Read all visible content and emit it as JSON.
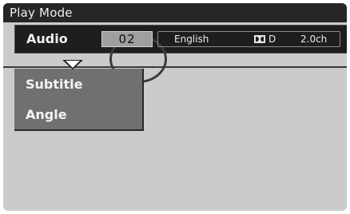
{
  "title_bar": {
    "title": "Play Mode"
  },
  "audio_row": {
    "label": "Audio",
    "track_number": "02",
    "language": "English",
    "dolby_icon": "dolby-icon",
    "dolby_suffix": "D",
    "channels": "2.0ch"
  },
  "submenu": {
    "items": [
      {
        "label": "Subtitle"
      },
      {
        "label": "Angle"
      }
    ]
  },
  "icons": {
    "expand_arrow": "chevron-down-icon"
  },
  "colors": {
    "title_bar_bg": "#262626",
    "menu_row_bg": "#1e1e1e",
    "submenu_bg": "#707070",
    "screen_bg": "#cbcbcb",
    "track_box_bg": "#9e9e9e"
  }
}
